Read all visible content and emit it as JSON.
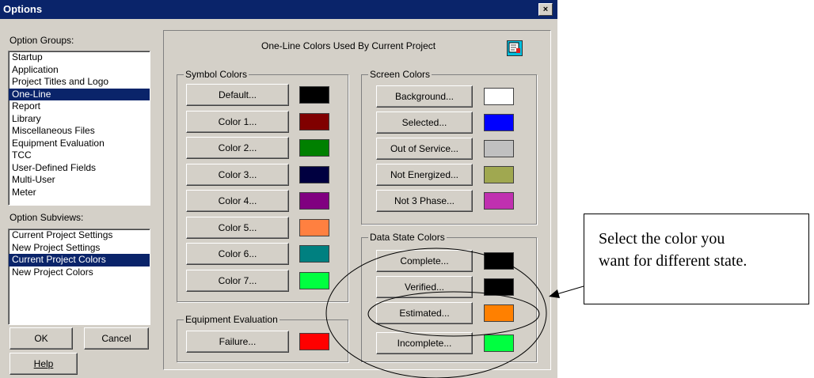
{
  "window": {
    "title": "Options",
    "close_glyph": "×"
  },
  "option_groups": {
    "label": "Option Groups:",
    "items": [
      "Startup",
      "Application",
      "Project Titles and Logo",
      "One-Line",
      "Report",
      "Library",
      "Miscellaneous Files",
      "Equipment Evaluation",
      "TCC",
      "User-Defined Fields",
      "Multi-User",
      "Meter"
    ],
    "selected": "One-Line"
  },
  "option_subviews": {
    "label": "Option Subviews:",
    "items": [
      "Current Project Settings",
      "New Project Settings",
      "Current Project Colors",
      "New Project Colors"
    ],
    "selected": "Current Project Colors"
  },
  "buttons": {
    "ok": "OK",
    "cancel": "Cancel",
    "help": "Help"
  },
  "panel": {
    "title": "One-Line Colors Used By Current Project",
    "icon": "palette-brush-icon"
  },
  "symbol_colors": {
    "title": "Symbol Colors",
    "items": [
      {
        "label": "Default...",
        "color": "#000000"
      },
      {
        "label": "Color 1...",
        "color": "#800000"
      },
      {
        "label": "Color 2...",
        "color": "#008000"
      },
      {
        "label": "Color 3...",
        "color": "#000040"
      },
      {
        "label": "Color 4...",
        "color": "#800080"
      },
      {
        "label": "Color 5...",
        "color": "#ff8040"
      },
      {
        "label": "Color 6...",
        "color": "#008080"
      },
      {
        "label": "Color 7...",
        "color": "#00ff40"
      }
    ]
  },
  "screen_colors": {
    "title": "Screen Colors",
    "items": [
      {
        "label": "Background...",
        "color": "#ffffff"
      },
      {
        "label": "Selected...",
        "color": "#0000ff"
      },
      {
        "label": "Out of Service...",
        "color": "#c0c0c0"
      },
      {
        "label": "Not Energized...",
        "color": "#a0a850"
      },
      {
        "label": "Not 3 Phase...",
        "color": "#c030b0"
      }
    ]
  },
  "data_state_colors": {
    "title": "Data State Colors",
    "items": [
      {
        "label": "Complete...",
        "color": "#000000"
      },
      {
        "label": "Verified...",
        "color": "#000000"
      },
      {
        "label": "Estimated...",
        "color": "#ff8000"
      },
      {
        "label": "Incomplete...",
        "color": "#00ff40"
      }
    ]
  },
  "equipment_evaluation": {
    "title": "Equipment Evaluation",
    "items": [
      {
        "label": "Failure...",
        "color": "#ff0000"
      }
    ]
  },
  "callout": {
    "line1": "Select the color you",
    "line2": "want for different state."
  }
}
